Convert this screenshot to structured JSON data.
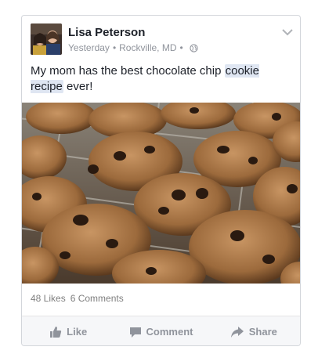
{
  "post": {
    "author": "Lisa Peterson",
    "time": "Yesterday",
    "separator": "•",
    "location": "Rockville, MD",
    "audience_icon": "globe-icon",
    "menu_icon": "chevron-down-icon",
    "text_before": "My mom has the best chocolate chip ",
    "text_highlight": "cookie recipe",
    "text_after": " ever!",
    "highlight_color": "#dfe6f2",
    "image_subject": "chocolate chip cookies on a cooling rack"
  },
  "stats": {
    "likes": "48 Likes",
    "comments": "6 Comments"
  },
  "actions": {
    "like": "Like",
    "comment": "Comment",
    "share": "Share"
  },
  "colors": {
    "text": "#1d2129",
    "meta": "#90949c",
    "border": "#d3d6db",
    "action_bar": "#f6f7f9"
  }
}
